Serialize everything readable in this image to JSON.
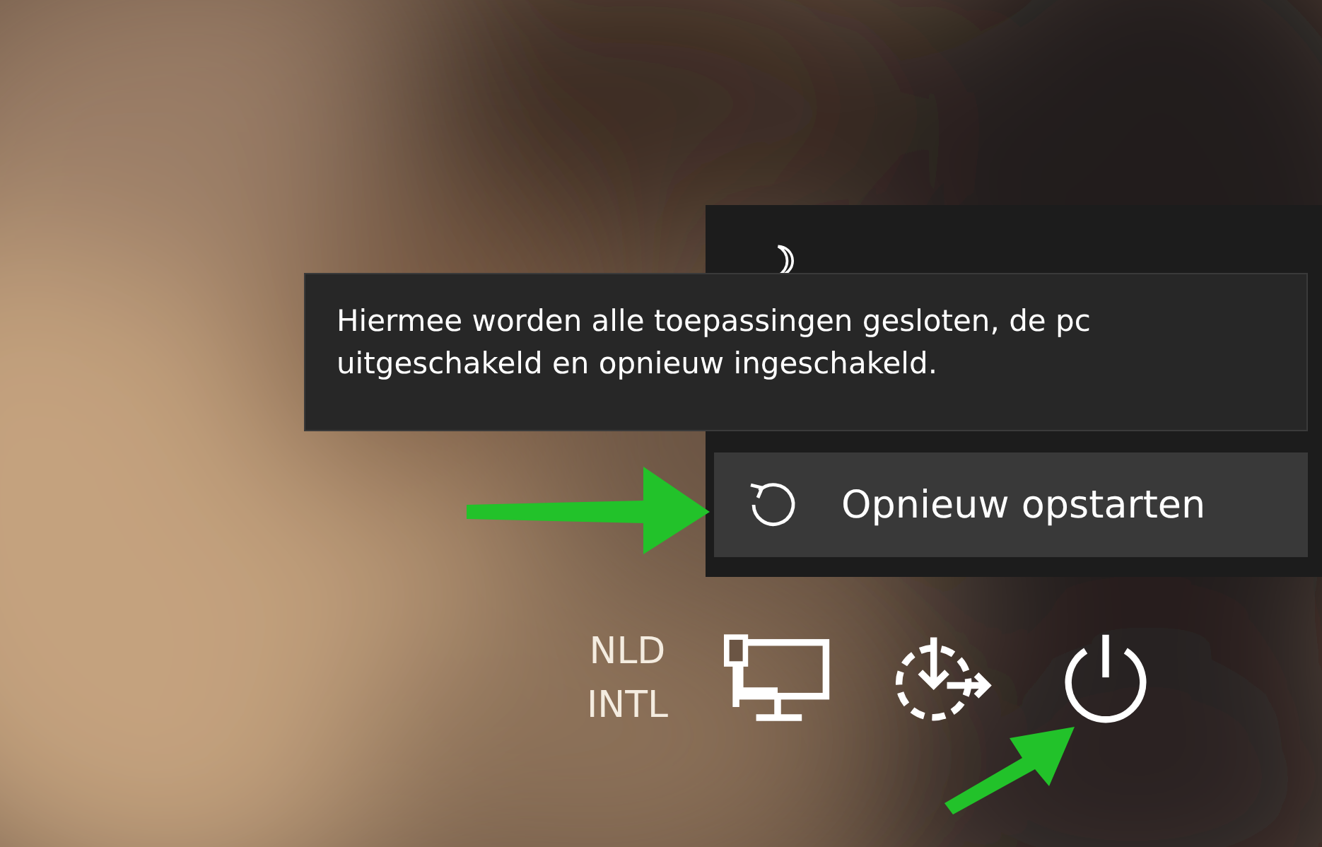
{
  "power_menu": {
    "items": [
      {
        "kind": "moon",
        "selected": false
      },
      {
        "kind": "restart",
        "label": "Opnieuw opstarten",
        "selected": true
      }
    ]
  },
  "tooltip": {
    "text": "Hiermee worden alle toepassingen gesloten, de pc uitgeschakeld en opnieuw ingeschakeld."
  },
  "taskbar": {
    "keyboard_layout": [
      "NLD",
      "INTL"
    ],
    "icons": [
      {
        "kind": "network"
      },
      {
        "kind": "ease"
      },
      {
        "kind": "power"
      }
    ]
  }
}
